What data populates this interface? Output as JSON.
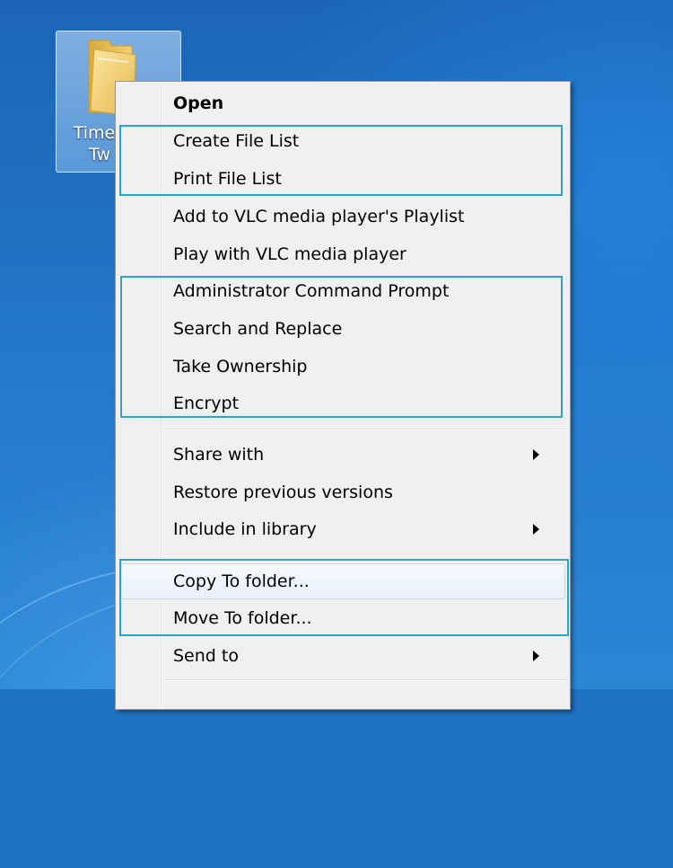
{
  "desktop": {
    "icon": {
      "name_line1": "Time",
      "name_line2": "Tw"
    }
  },
  "context_menu": {
    "items": [
      {
        "label": "Open"
      },
      {
        "label": "Create File List"
      },
      {
        "label": "Print File List"
      },
      {
        "label": "Add to VLC media player's Playlist"
      },
      {
        "label": "Play with VLC media player"
      },
      {
        "label": "Administrator Command Prompt"
      },
      {
        "label": "Search and Replace"
      },
      {
        "label": "Take Ownership"
      },
      {
        "label": "Encrypt"
      },
      {
        "label": "Share with",
        "submenu": true
      },
      {
        "label": "Restore previous versions"
      },
      {
        "label": "Include in library",
        "submenu": true
      },
      {
        "label": "Copy To folder...",
        "highlighted": true
      },
      {
        "label": "Move To folder..."
      },
      {
        "label": "Send to",
        "submenu": true
      }
    ]
  },
  "colors": {
    "desktop_blue": "#2479cc",
    "menu_background": "#f0f0f0",
    "group_highlight": "#2aa4c8"
  }
}
